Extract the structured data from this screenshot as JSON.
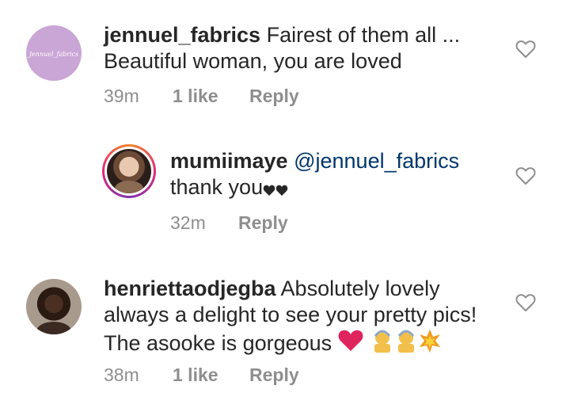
{
  "comments": [
    {
      "username": "jennuel_fabrics",
      "avatar_text": "Jennuel_fabrics",
      "avatar_color": "#c9a6d6",
      "line1": "Fairest of them all ...",
      "line2": "Beautiful woman, you are loved",
      "time": "39m",
      "likes": "1 like",
      "reply": "Reply",
      "icon": "heart-outline-icon"
    },
    {
      "username": "mumiimaye",
      "mention": "@jennuel_fabrics",
      "line2": "thank you",
      "time": "32m",
      "reply": "Reply",
      "story_ring_colors": [
        "#f58529",
        "#dd2a7b",
        "#8134af"
      ],
      "icon": "heart-outline-icon"
    },
    {
      "username": "henriettaodjegba",
      "line1": "Absolutely lovely",
      "line2": "always a delight to see your pretty pics!",
      "line3": "The asooke is gorgeous",
      "time": "38m",
      "likes": "1 like",
      "reply": "Reply",
      "icon": "heart-outline-icon"
    }
  ],
  "colors": {
    "text": "#262626",
    "secondary": "#8e8e8e",
    "mention": "#00376b",
    "heart_emoji": "#e0245e"
  }
}
